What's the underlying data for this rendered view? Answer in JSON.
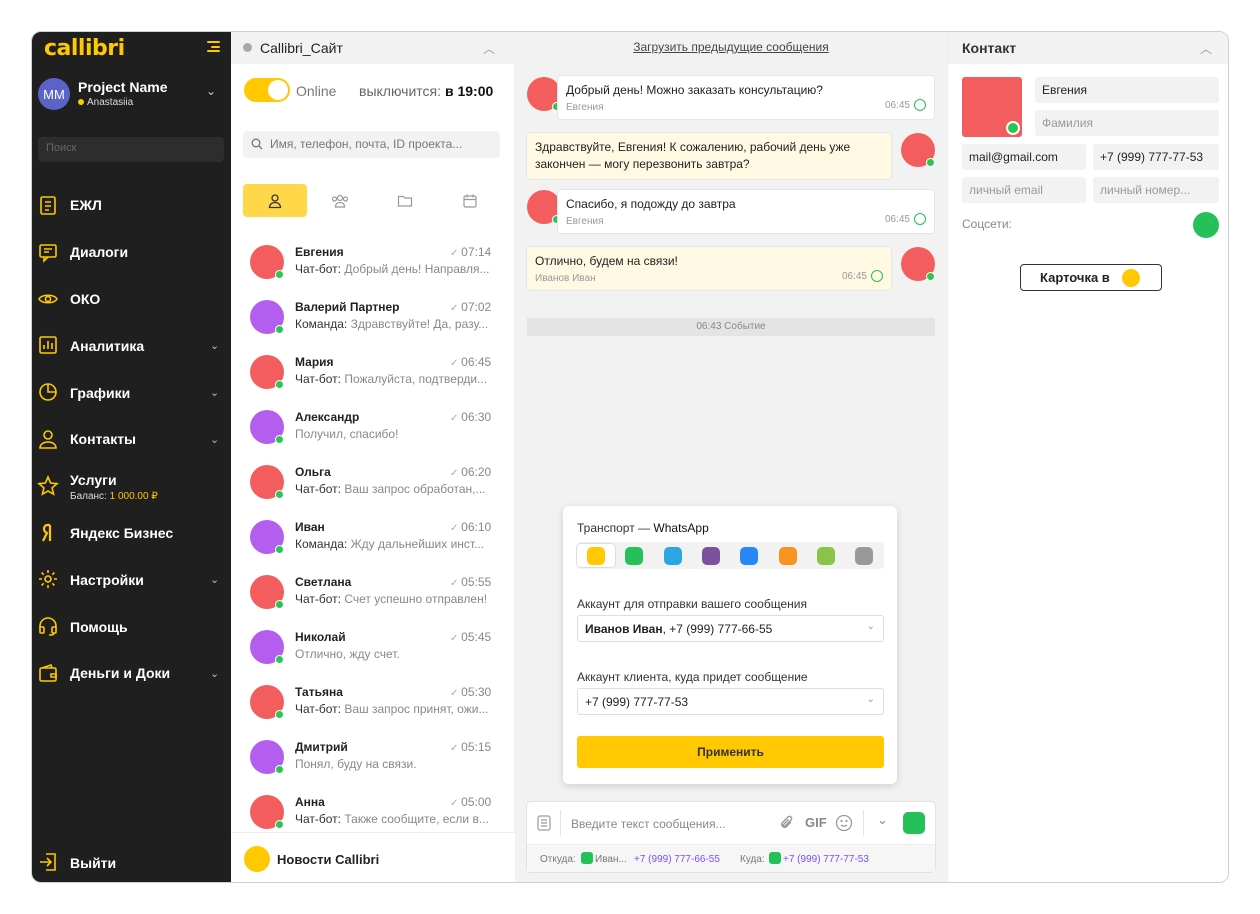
{
  "app": {
    "logo": "callibri"
  },
  "sidebar": {
    "project_initials": "MM",
    "project_name": "Project Name",
    "user": "Anastasiia",
    "search_placeholder": "Поиск",
    "items": [
      {
        "label": "ЕЖЛ",
        "icon": "journal-icon",
        "chevron": false
      },
      {
        "label": "Диалоги",
        "icon": "chat-icon",
        "chevron": false
      },
      {
        "label": "ОКО",
        "icon": "eye-icon",
        "chevron": false
      },
      {
        "label": "Аналитика",
        "icon": "analytics-icon",
        "chevron": true
      },
      {
        "label": "Графики",
        "icon": "pie-chart-icon",
        "chevron": true
      },
      {
        "label": "Контакты",
        "icon": "person-icon",
        "chevron": true
      },
      {
        "label": "Услуги",
        "icon": "star-icon",
        "chevron": false,
        "sub_prefix": "Баланс: ",
        "sub_value": "1 000.00 ₽"
      },
      {
        "label": "Яндекс Бизнес",
        "icon": "yandex-icon",
        "chevron": false
      },
      {
        "label": "Настройки",
        "icon": "gear-icon",
        "chevron": true
      },
      {
        "label": "Помощь",
        "icon": "headset-icon",
        "chevron": false
      },
      {
        "label": "Деньги и Доки",
        "icon": "wallet-icon",
        "chevron": true
      }
    ],
    "exit_label": "Выйти"
  },
  "list": {
    "header": "Callibri_Сайт",
    "online_label": "Online",
    "off_label": "выключится:",
    "off_time": "в 19:00",
    "search_placeholder": "Имя, телефон, почта, ID проекта...",
    "chats": [
      {
        "name": "Евгения",
        "time": "07:14",
        "prefix": "Чат-бот:",
        "text": " Добрый день! Направля...",
        "color": "#f35d5d"
      },
      {
        "name": "Валерий Партнер",
        "time": "07:02",
        "prefix": "Команда:",
        "text": " Здравствуйте! Да, разу...",
        "color": "#b45ef0"
      },
      {
        "name": "Мария",
        "time": "06:45",
        "prefix": "Чат-бот:",
        "text": " Пожалуйста, подтверди...",
        "color": "#f35d5d"
      },
      {
        "name": "Александр",
        "time": "06:30",
        "prefix": "",
        "text": "Получил, спасибо!",
        "color": "#b45ef0"
      },
      {
        "name": "Ольга",
        "time": "06:20",
        "prefix": "Чат-бот:",
        "text": " Ваш запрос обработан,...",
        "color": "#f35d5d"
      },
      {
        "name": "Иван",
        "time": "06:10",
        "prefix": "Команда:",
        "text": " Жду дальнейших инст...",
        "color": "#b45ef0"
      },
      {
        "name": "Светлана",
        "time": "05:55",
        "prefix": "Чат-бот:",
        "text": " Счет успешно отправлен!",
        "color": "#f35d5d"
      },
      {
        "name": "Николай",
        "time": "05:45",
        "prefix": "",
        "text": "Отлично, жду счет.",
        "color": "#b45ef0"
      },
      {
        "name": "Татьяна",
        "time": "05:30",
        "prefix": "Чат-бот:",
        "text": " Ваш запрос принят, ожи...",
        "color": "#f35d5d"
      },
      {
        "name": "Дмитрий",
        "time": "05:15",
        "prefix": "",
        "text": "Понял, буду на связи.",
        "color": "#b45ef0"
      },
      {
        "name": "Анна",
        "time": "05:00",
        "prefix": "Чат-бот:",
        "text": " Также сообщите, если в...",
        "color": "#f35d5d"
      }
    ],
    "news_label": "Новости Callibri"
  },
  "chat": {
    "load_prev": "Загрузить предыдущие сообщения",
    "messages": [
      {
        "text": "Добрый день! Можно заказать консультацию?",
        "author": "Евгения",
        "time": "06:45"
      },
      {
        "text": "Здравствуйте, Евгения! К сожалению, рабочий день уже закончен — могу перезвонить завтра?",
        "author": "",
        "time": ""
      },
      {
        "text": "Спасибо, я подожду до завтра",
        "author": "Евгения",
        "time": "06:45"
      },
      {
        "text": "Отлично, будем на связи!",
        "author": "Иванов Иван",
        "time": "06:45"
      }
    ],
    "event": "06:43 Событие",
    "popup": {
      "transport_prefix": "Транспорт — ",
      "transport_name": "WhatsApp",
      "transports": [
        {
          "icon": "callibri-icon",
          "color": "#ffc800"
        },
        {
          "icon": "whatsapp-icon",
          "color": "#25c05a"
        },
        {
          "icon": "telegram-icon",
          "color": "#2ca5e0"
        },
        {
          "icon": "viber-icon",
          "color": "#7b519d"
        },
        {
          "icon": "vk-icon",
          "color": "#2787f5"
        },
        {
          "icon": "odnoklassniki-icon",
          "color": "#f7931e"
        },
        {
          "icon": "vk-messenger-icon",
          "color": "#8bc34a"
        },
        {
          "icon": "sms-icon",
          "color": "#999999"
        }
      ],
      "sender_label": "Аккаунт для отправки вашего сообщения",
      "sender_name": "Иванов Иван",
      "sender_phone": ", +7 (999) 777-66-55",
      "client_label": "Аккаунт клиента, куда придет сообщение",
      "client_phone": "+7 (999) 777-77-53",
      "apply_label": "Применить"
    },
    "composer": {
      "placeholder": "Введите текст сообщения...",
      "gif_label": "GIF",
      "from_label": "Откуда:",
      "from_name": "Иван...",
      "from_phone": "+7 (999) 777-66-55",
      "to_label": "Куда:",
      "to_phone": "+7 (999) 777-77-53"
    }
  },
  "contact": {
    "header": "Контакт",
    "first_name": "Евгения",
    "last_name_placeholder": "Фамилия",
    "email": "mail@gmail.com",
    "phone": "+7 (999) 777-77-53",
    "personal_email_placeholder": "личный email",
    "personal_phone_placeholder": "личный номер...",
    "social_label": "Соцсети:",
    "card_label": "Карточка в"
  },
  "colors": {
    "accent": "#ffc800",
    "sidebar": "#1f1f1f",
    "online": "#29c653",
    "avatar_red": "#f35d5d",
    "avatar_purple": "#b45ef0"
  }
}
